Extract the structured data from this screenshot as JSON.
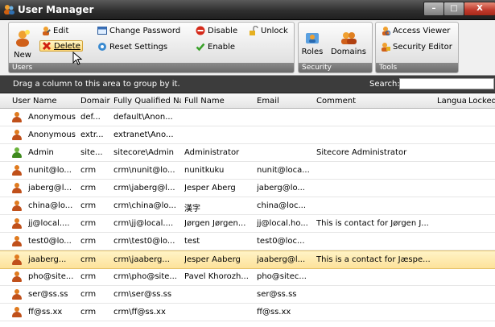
{
  "window": {
    "title": "User Manager",
    "controls": {
      "minimize": "–",
      "maximize": "□",
      "close": "X"
    }
  },
  "ribbon": {
    "users_group": {
      "label": "Users",
      "new": "New",
      "edit": "Edit",
      "delete": "Delete",
      "change_password": "Change Password",
      "reset_settings": "Reset Settings",
      "disable": "Disable",
      "enable": "Enable",
      "unlock": "Unlock"
    },
    "security_group": {
      "label": "Security",
      "roles": "Roles",
      "domains": "Domains"
    },
    "tools_group": {
      "label": "Tools",
      "access_viewer": "Access Viewer",
      "security_editor": "Security Editor"
    }
  },
  "groupbar": {
    "hint": "Drag a column to this area to group by it.",
    "search_label": "Search:",
    "search_value": ""
  },
  "grid": {
    "columns": [
      "User Name",
      "Domair",
      "Fully Qualified Næ",
      "Full Name",
      "Email",
      "Comment",
      "Langua",
      "Locked"
    ],
    "rows": [
      {
        "user": "Anonymous",
        "domain": "def...",
        "fqn": "default\\Anon...",
        "full": "",
        "email": "",
        "comment": "",
        "icon": "orange"
      },
      {
        "user": "Anonymous",
        "domain": "extr...",
        "fqn": "extranet\\Ano...",
        "full": "",
        "email": "",
        "comment": "",
        "icon": "orange"
      },
      {
        "user": "Admin",
        "domain": "site...",
        "fqn": "sitecore\\Admin",
        "full": "Administrator",
        "email": "",
        "comment": "Sitecore Administrator",
        "icon": "green"
      },
      {
        "user": "nunit@lo...",
        "domain": "crm",
        "fqn": "crm\\nunit@lo...",
        "full": "nunitkuku",
        "email": "nunit@loca...",
        "comment": "",
        "icon": "orange"
      },
      {
        "user": "jaberg@l...",
        "domain": "crm",
        "fqn": "crm\\jaberg@l...",
        "full": "Jesper Aberg",
        "email": "jaberg@lo...",
        "comment": "",
        "icon": "orange"
      },
      {
        "user": "china@lo...",
        "domain": "crm",
        "fqn": "crm\\china@lo...",
        "full": "漢字",
        "email": "china@loc...",
        "comment": "",
        "icon": "orange"
      },
      {
        "user": "jj@local....",
        "domain": "crm",
        "fqn": "crm\\jj@local....",
        "full": "Jørgen Jørgen...",
        "email": "jj@local.ho...",
        "comment": "This is contact for Jørgen J...",
        "icon": "orange"
      },
      {
        "user": "test0@lo...",
        "domain": "crm",
        "fqn": "crm\\test0@lo...",
        "full": "test",
        "email": "test0@loc...",
        "comment": "",
        "icon": "orange"
      },
      {
        "user": "jaaberg...",
        "domain": "crm",
        "fqn": "crm\\jaaberg...",
        "full": "Jesper Aaberg",
        "email": "jaaberg@l...",
        "comment": "This is a contact for Jæspe...",
        "icon": "orange",
        "selected": true
      },
      {
        "user": "pho@site...",
        "domain": "crm",
        "fqn": "crm\\pho@site...",
        "full": "Pavel Khorozh...",
        "email": "pho@sitec...",
        "comment": "",
        "icon": "orange"
      },
      {
        "user": "ser@ss.ss",
        "domain": "crm",
        "fqn": "crm\\ser@ss.ss",
        "full": "",
        "email": "ser@ss.ss",
        "comment": "",
        "icon": "orange"
      },
      {
        "user": "ff@ss.xx",
        "domain": "crm",
        "fqn": "crm\\ff@ss.xx",
        "full": "",
        "email": "ff@ss.xx",
        "comment": "",
        "icon": "orange"
      }
    ]
  },
  "colors": {
    "selected_row": "#fde29a",
    "header_dark": "#3c3c3c",
    "user_orange": "#e07b1f",
    "user_green": "#6bb33a"
  }
}
